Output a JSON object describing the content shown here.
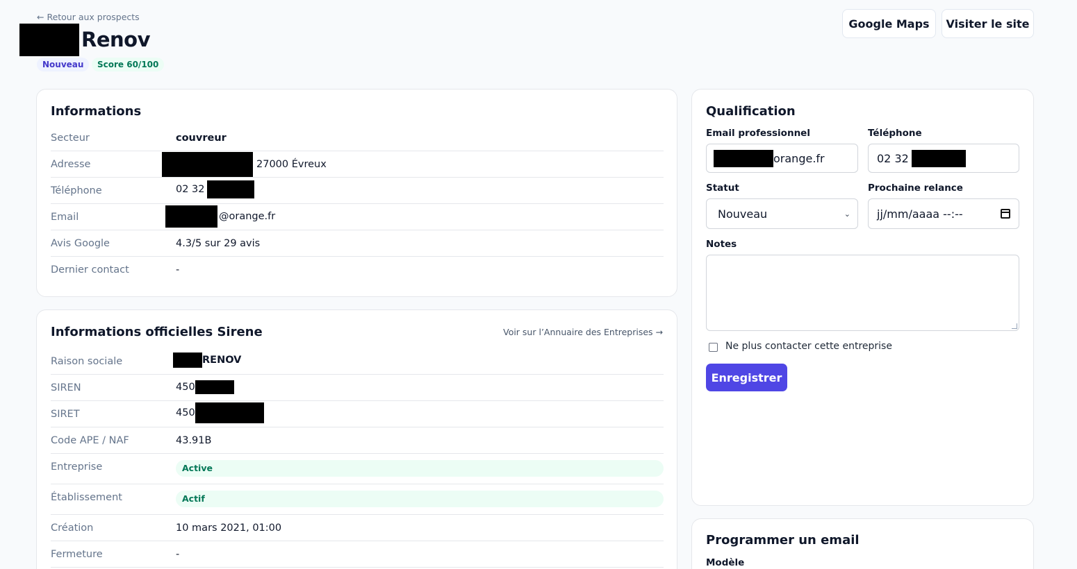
{
  "header": {
    "back_link": "← Retour aux prospects",
    "title": "Renov",
    "status_badge": "Nouveau",
    "score_badge": "Score 60/100",
    "maps_button": "Google Maps",
    "site_button": "Visiter le site"
  },
  "informations": {
    "title": "Informations",
    "rows": [
      {
        "label": "Secteur",
        "value": "couvreur"
      },
      {
        "label": "Adresse",
        "value": "27000 Évreux"
      },
      {
        "label": "Téléphone",
        "value": "02 32"
      },
      {
        "label": "Email",
        "value": "@orange.fr"
      },
      {
        "label": "Avis Google",
        "value": "4.3/5 sur 29 avis"
      },
      {
        "label": "Dernier contact",
        "value": "-"
      }
    ]
  },
  "sirene": {
    "title": "Informations officielles Sirene",
    "link": "Voir sur l’Annuaire des Entreprises →",
    "rows": [
      {
        "label": "Raison sociale",
        "value": "RENOV"
      },
      {
        "label": "SIREN",
        "value": "450"
      },
      {
        "label": "SIRET",
        "value": "450"
      },
      {
        "label": "Code APE / NAF",
        "value": "43.91B"
      },
      {
        "label": "Entreprise",
        "value": "Active"
      },
      {
        "label": "Établissement",
        "value": "Actif"
      },
      {
        "label": "Création",
        "value": "10 mars 2021, 01:00"
      },
      {
        "label": "Fermeture",
        "value": "-"
      }
    ]
  },
  "qualification": {
    "title": "Qualification",
    "email_label": "Email professionnel",
    "email_value": "orange.fr",
    "phone_label": "Téléphone",
    "phone_value": "02 32",
    "status_label": "Statut",
    "status_value": "Nouveau",
    "relance_label": "Prochaine relance",
    "relance_value": "jj/mm/aaaa  --:--",
    "notes_label": "Notes",
    "notes_value": "",
    "no_contact_label": "Ne plus contacter cette entreprise",
    "no_contact_checked": false,
    "save_button": "Enregistrer"
  },
  "schedule_email": {
    "title": "Programmer un email",
    "template_label": "Modèle"
  }
}
